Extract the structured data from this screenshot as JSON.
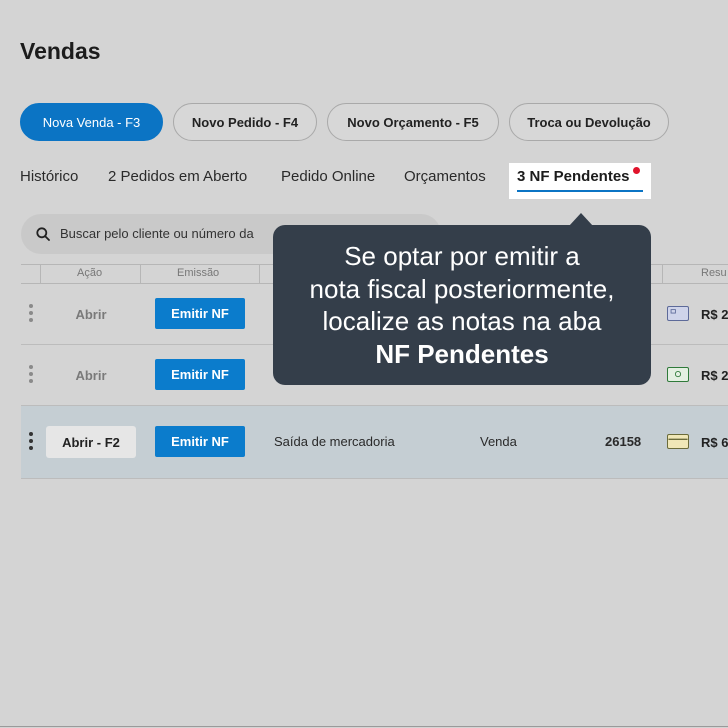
{
  "page_title": "Vendas",
  "actions": [
    {
      "label": "Nova Venda - F3"
    },
    {
      "label": "Novo Pedido - F4"
    },
    {
      "label": "Novo Orçamento - F5"
    },
    {
      "label": "Troca ou Devolução"
    }
  ],
  "tabs": [
    {
      "label": "Histórico"
    },
    {
      "label": "2 Pedidos em Aberto"
    },
    {
      "label": "Pedido Online"
    },
    {
      "label": "Orçamentos"
    },
    {
      "label": "3 NF Pendentes",
      "active": true,
      "notification": true
    }
  ],
  "search": {
    "placeholder": "Buscar pelo cliente ou número da"
  },
  "table": {
    "headers": [
      "Ação",
      "Emissão",
      "Resu"
    ],
    "rows": [
      {
        "open": "Abrir",
        "emit": "Emitir NF",
        "type": "",
        "operation": "",
        "number": "",
        "payment_icon": "credit-card-icon",
        "amount": "R$ 2"
      },
      {
        "open": "Abrir",
        "emit": "Emitir NF",
        "type": "",
        "operation": "",
        "number": "",
        "payment_icon": "cash-icon",
        "amount": "R$ 2"
      },
      {
        "open": "Abrir - F2",
        "emit": "Emitir NF",
        "type": "Saída de mercadoria",
        "operation": "Venda",
        "number": "26158",
        "payment_icon": "card-icon",
        "amount": "R$ 6",
        "selected": true
      }
    ]
  },
  "tooltip": {
    "lines": [
      "Se optar por emitir a",
      "nota fiscal posteriormente,",
      "localize as notas na aba"
    ],
    "bold": "NF Pendentes"
  },
  "colors": {
    "primary": "#0b74c4",
    "tooltip_bg": "#343e4a",
    "notification": "#e0132b",
    "background": "#d4d4d4"
  }
}
